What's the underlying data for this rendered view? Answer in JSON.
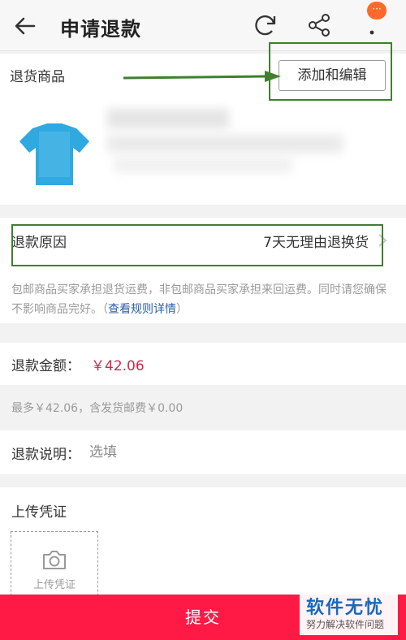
{
  "header": {
    "title": "申请退款",
    "back_icon": "back-arrow-icon",
    "refresh_icon": "refresh-icon",
    "share_icon": "share-icon",
    "more_icon": "more-vertical-icon",
    "notification_text": "···"
  },
  "goods": {
    "label": "退货商品",
    "edit_button": "添加和编辑"
  },
  "reason": {
    "label": "退款原因",
    "value": "7天无理由退换货",
    "notice_text": "包邮商品买家承担退货运费，非包邮商品买家承担来回运费。同时请您确保不影响商品完好。（",
    "notice_link": "查看规则详情",
    "notice_end": "）"
  },
  "amount": {
    "label": "退款金额：",
    "value": "￥42.06",
    "note": "最多￥42.06，含发货邮费￥0.00"
  },
  "description": {
    "label": "退款说明：",
    "placeholder": "选填"
  },
  "upload": {
    "label": "上传凭证",
    "box_text": "上传凭证"
  },
  "submit": {
    "label": "提交"
  },
  "watermark": {
    "main": "软件无忧",
    "sub": "努力解决软件问题"
  },
  "colors": {
    "accent": "#ff1a46",
    "price": "#d3264d",
    "link": "#2b5ea8",
    "highlight": "#3f7f2f"
  }
}
